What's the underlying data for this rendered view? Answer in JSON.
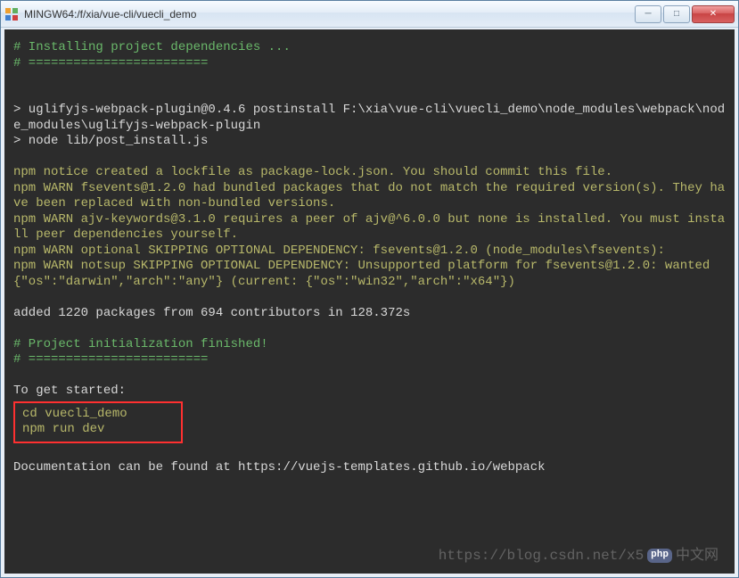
{
  "window": {
    "title": "MINGW64:/f/xia/vue-cli/vuecli_demo",
    "buttons": {
      "min": "─",
      "max": "□",
      "close": "✕"
    }
  },
  "terminal": {
    "line1": "# Installing project dependencies ...",
    "line2": "# ========================",
    "blank": "",
    "line3": "> uglifyjs-webpack-plugin@0.4.6 postinstall F:\\xia\\vue-cli\\vuecli_demo\\node_modules\\webpack\\node_modules\\uglifyjs-webpack-plugin",
    "line4": "> node lib/post_install.js",
    "line5": "npm notice created a lockfile as package-lock.json. You should commit this file.",
    "line6": "npm WARN fsevents@1.2.0 had bundled packages that do not match the required version(s). They have been replaced with non-bundled versions.",
    "line7": "npm WARN ajv-keywords@3.1.0 requires a peer of ajv@^6.0.0 but none is installed. You must install peer dependencies yourself.",
    "line8": "npm WARN optional SKIPPING OPTIONAL DEPENDENCY: fsevents@1.2.0 (node_modules\\fsevents):",
    "line9": "npm WARN notsup SKIPPING OPTIONAL DEPENDENCY: Unsupported platform for fsevents@1.2.0: wanted {\"os\":\"darwin\",\"arch\":\"any\"} (current: {\"os\":\"win32\",\"arch\":\"x64\"})",
    "line10": "added 1220 packages from 694 contributors in 128.372s",
    "line11": "# Project initialization finished!",
    "line12": "# ========================",
    "line13": "To get started:",
    "highlight1": "cd vuecli_demo",
    "highlight2": "npm run dev",
    "line14": "Documentation can be found at https://vuejs-templates.github.io/webpack"
  },
  "watermark": {
    "text": "https://blog.csdn.net/x5",
    "badge": "php",
    "suffix": "中文网"
  }
}
